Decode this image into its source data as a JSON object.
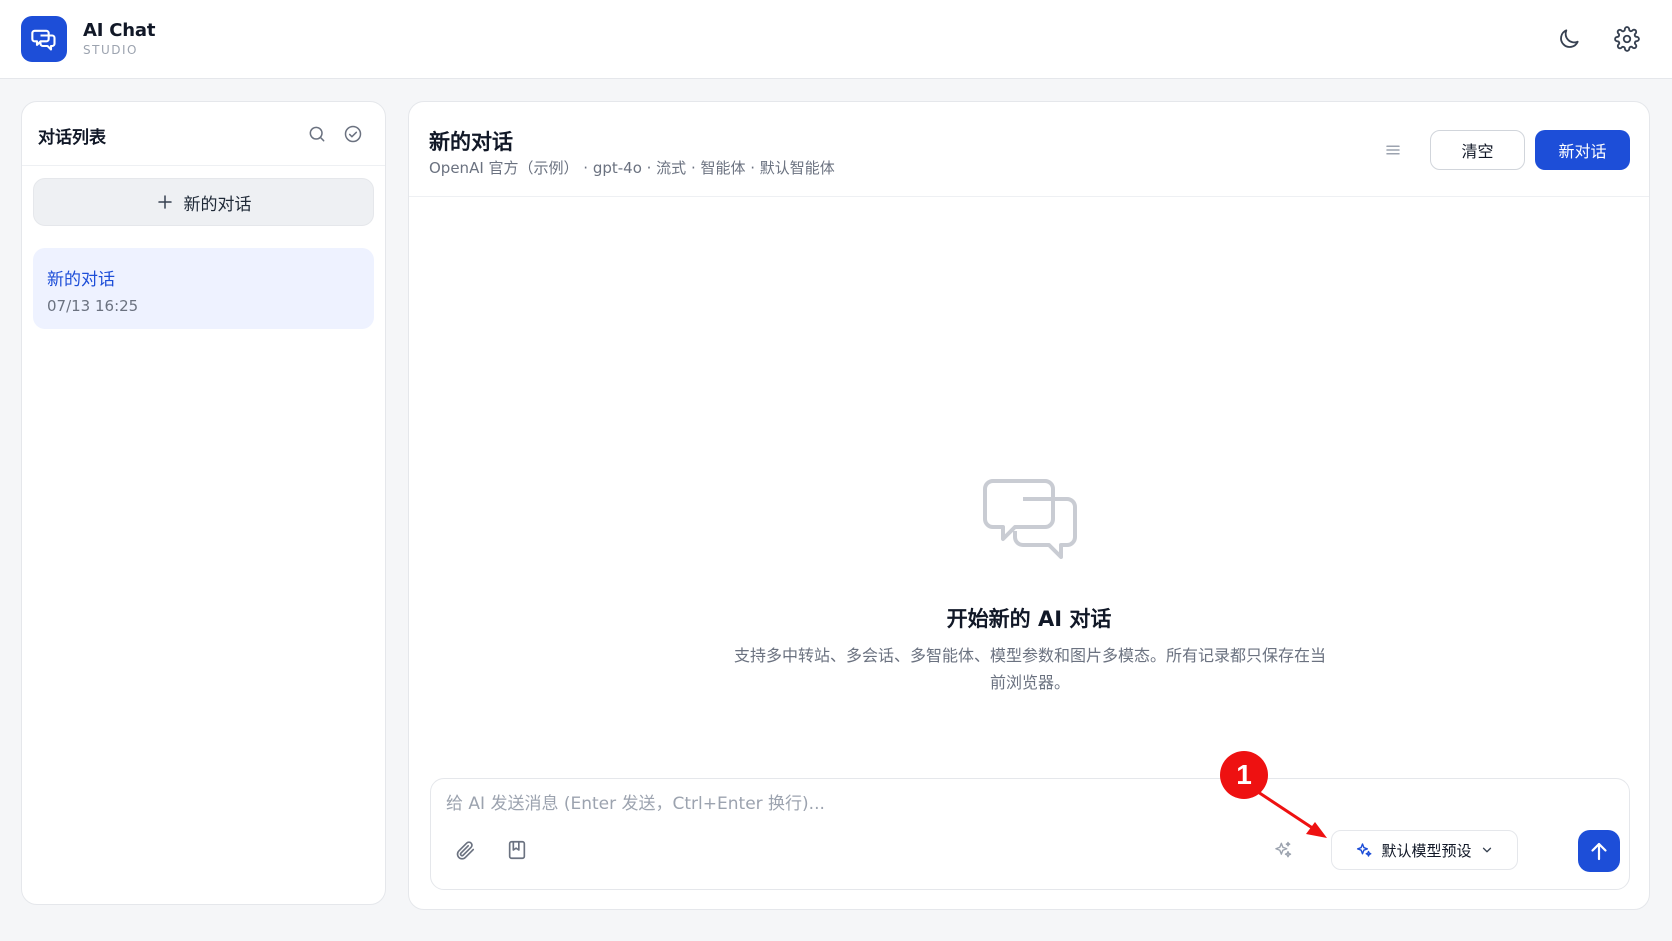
{
  "app": {
    "title": "AI Chat",
    "subtitle": "STUDIO",
    "accent_color": "#1d4ed8"
  },
  "topbar": {
    "icons": [
      "moon-icon",
      "gear-icon"
    ]
  },
  "sidebar": {
    "title": "对话列表",
    "icons": [
      "search-icon",
      "check-circle-icon"
    ],
    "new_chat_label": "新的对话",
    "conversations": [
      {
        "title": "新的对话",
        "time": "07/13 16:25",
        "active": true
      }
    ]
  },
  "main": {
    "title": "新的对话",
    "meta": "OpenAI 官方（示例） · gpt-4o · 流式 · 智能体 · 默认智能体",
    "clear_label": "清空",
    "new_chat_label": "新对话",
    "empty_title": "开始新的 AI 对话",
    "empty_desc": "支持多中转站、多会话、多智能体、模型参数和图片多模态。所有记录都只保存在当前浏览器。"
  },
  "composer": {
    "placeholder": "给 AI 发送消息 (Enter 发送，Ctrl+Enter 换行)...",
    "value": "",
    "preset_label": "默认模型预设",
    "icons": [
      "paperclip-icon",
      "bookmark-icon",
      "sparkles-icon",
      "send-arrow-icon"
    ]
  },
  "annotation": {
    "badge": "1",
    "color": "#ee1111"
  }
}
